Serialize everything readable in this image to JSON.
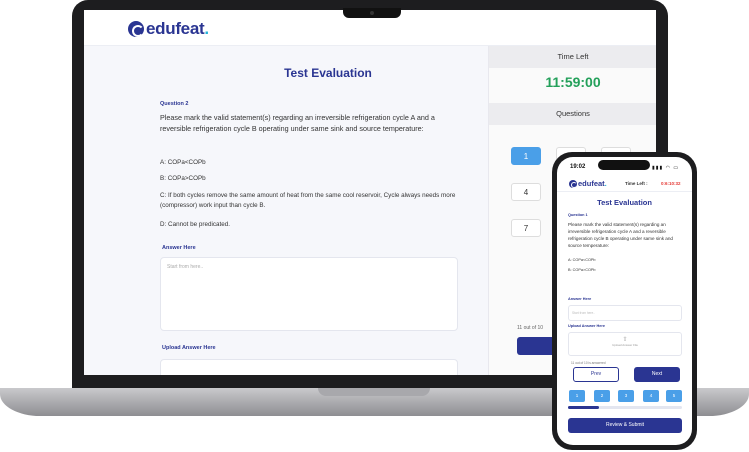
{
  "brand": {
    "name": "edufeat",
    "suffix": "."
  },
  "desktop": {
    "title": "Test Evaluation",
    "question_label": "Question 2",
    "question_text": "Please mark the valid statement(s) regarding an irreversible refrigeration cycle A and a reversible refrigeration cycle B operating under same sink and source temperature:",
    "options": {
      "a": "A:  COPa<COPb",
      "b": "B:  COPa>COPb",
      "c": "C: If both cycles remove the same amount of heat from the same cool reservoir, Cycle always needs more (compressor) work input than cycle B.",
      "d": "D:  Cannot be predicated."
    },
    "answer_label": "Answer Here",
    "answer_placeholder": "Start from here..",
    "upload_label": "Upload Answer Here",
    "time_left_label": "Time Left",
    "timer": "11:59:00",
    "questions_label": "Questions",
    "question_buttons": [
      "1",
      "",
      "",
      "4",
      "",
      "",
      "7",
      ""
    ],
    "attempted": "11 out of 10"
  },
  "mobile": {
    "clock": "19:02",
    "status_icons": "▮▮▮ ◠ ▭",
    "time_left_label": "Time Left :",
    "timer": "0:6:10:32",
    "title": "Test Evaluation",
    "question_label": "Question 1",
    "question_text": "Please mark the valid statement(s) regarding an irreversible refrigeration cycle A and a reversible refrigeration cycle B operating under same sink and source temperature:",
    "options": {
      "a": "A:  COPa<COPb",
      "b": "B:  COPa>COPb"
    },
    "answer_label": "Answer Here",
    "answer_placeholder": "Start from here..",
    "upload_label": "Upload Answer Here",
    "upload_hint": "Upload Answer File",
    "upload_icon": "⇧",
    "attempted": "11 out of 10 is answered",
    "prev_label": "Prev",
    "next_label": "Next",
    "question_buttons": [
      "1",
      "2",
      "3",
      "4",
      "5"
    ],
    "progress": 0.27,
    "submit_label": "Review & Submit"
  },
  "colors": {
    "primary": "#2a3592",
    "accent": "#4a9fe8",
    "timer_green": "#23a05a",
    "timer_red": "#e53935"
  }
}
